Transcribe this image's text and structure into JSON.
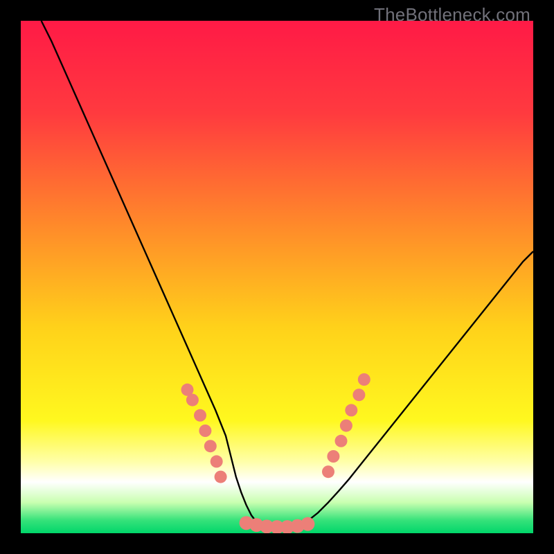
{
  "watermark": "TheBottleneck.com",
  "colors": {
    "curve": "#000000",
    "marker_fill": "#ec7f78",
    "marker_stroke": "#d86a63",
    "gradient_stops": [
      {
        "offset": 0.0,
        "color": "#ff1a46"
      },
      {
        "offset": 0.18,
        "color": "#ff3a3f"
      },
      {
        "offset": 0.4,
        "color": "#ff8a2a"
      },
      {
        "offset": 0.6,
        "color": "#ffd21a"
      },
      {
        "offset": 0.78,
        "color": "#fff81f"
      },
      {
        "offset": 0.86,
        "color": "#ffffa8"
      },
      {
        "offset": 0.9,
        "color": "#ffffff"
      },
      {
        "offset": 0.94,
        "color": "#c9ffb0"
      },
      {
        "offset": 0.975,
        "color": "#35e27a"
      },
      {
        "offset": 1.0,
        "color": "#00d66a"
      }
    ]
  },
  "chart_data": {
    "type": "line",
    "title": "",
    "xlabel": "",
    "ylabel": "",
    "x_range": [
      0,
      100
    ],
    "y_range": [
      0,
      100
    ],
    "series": [
      {
        "name": "bottleneck-curve",
        "x": [
          4,
          6,
          8,
          10,
          12,
          14,
          16,
          18,
          20,
          22,
          24,
          26,
          28,
          30,
          32,
          34,
          36,
          38,
          40,
          41,
          42,
          43,
          44,
          45,
          46,
          47,
          48,
          49,
          50,
          51,
          52,
          53,
          54,
          56,
          58,
          60,
          62,
          64,
          66,
          68,
          70,
          72,
          74,
          76,
          78,
          80,
          82,
          84,
          86,
          88,
          90,
          92,
          94,
          96,
          98,
          100
        ],
        "y": [
          100,
          96,
          91.5,
          87,
          82.5,
          78,
          73.5,
          69,
          64.5,
          60,
          55.5,
          51,
          46.5,
          42,
          37.5,
          33,
          28.5,
          24,
          19,
          15,
          11,
          8,
          5.5,
          3.5,
          2.2,
          1.4,
          1.1,
          1.0,
          1.0,
          1.0,
          1.0,
          1.1,
          1.4,
          2.4,
          4.0,
          6.0,
          8.2,
          10.5,
          13.0,
          15.5,
          18.0,
          20.5,
          23.0,
          25.5,
          28.0,
          30.5,
          33.0,
          35.5,
          38.0,
          40.5,
          43.0,
          45.5,
          48.0,
          50.5,
          53.0,
          55.0
        ]
      }
    ],
    "markers": {
      "left_cluster": {
        "x": [
          32.5,
          33.5,
          35.0,
          36.0,
          37.0,
          38.2,
          39.0
        ],
        "y": [
          28.0,
          26.0,
          23.0,
          20.0,
          17.0,
          14.0,
          11.0
        ]
      },
      "floor": {
        "x": [
          44.0,
          46.0,
          48.0,
          50.0,
          52.0,
          54.0,
          56.0
        ],
        "y": [
          2.0,
          1.6,
          1.3,
          1.2,
          1.2,
          1.4,
          1.8
        ]
      },
      "right_cluster": {
        "x": [
          60.0,
          61.0,
          62.5,
          63.5,
          64.5,
          66.0,
          67.0
        ],
        "y": [
          12.0,
          15.0,
          18.0,
          21.0,
          24.0,
          27.0,
          30.0
        ]
      }
    }
  }
}
